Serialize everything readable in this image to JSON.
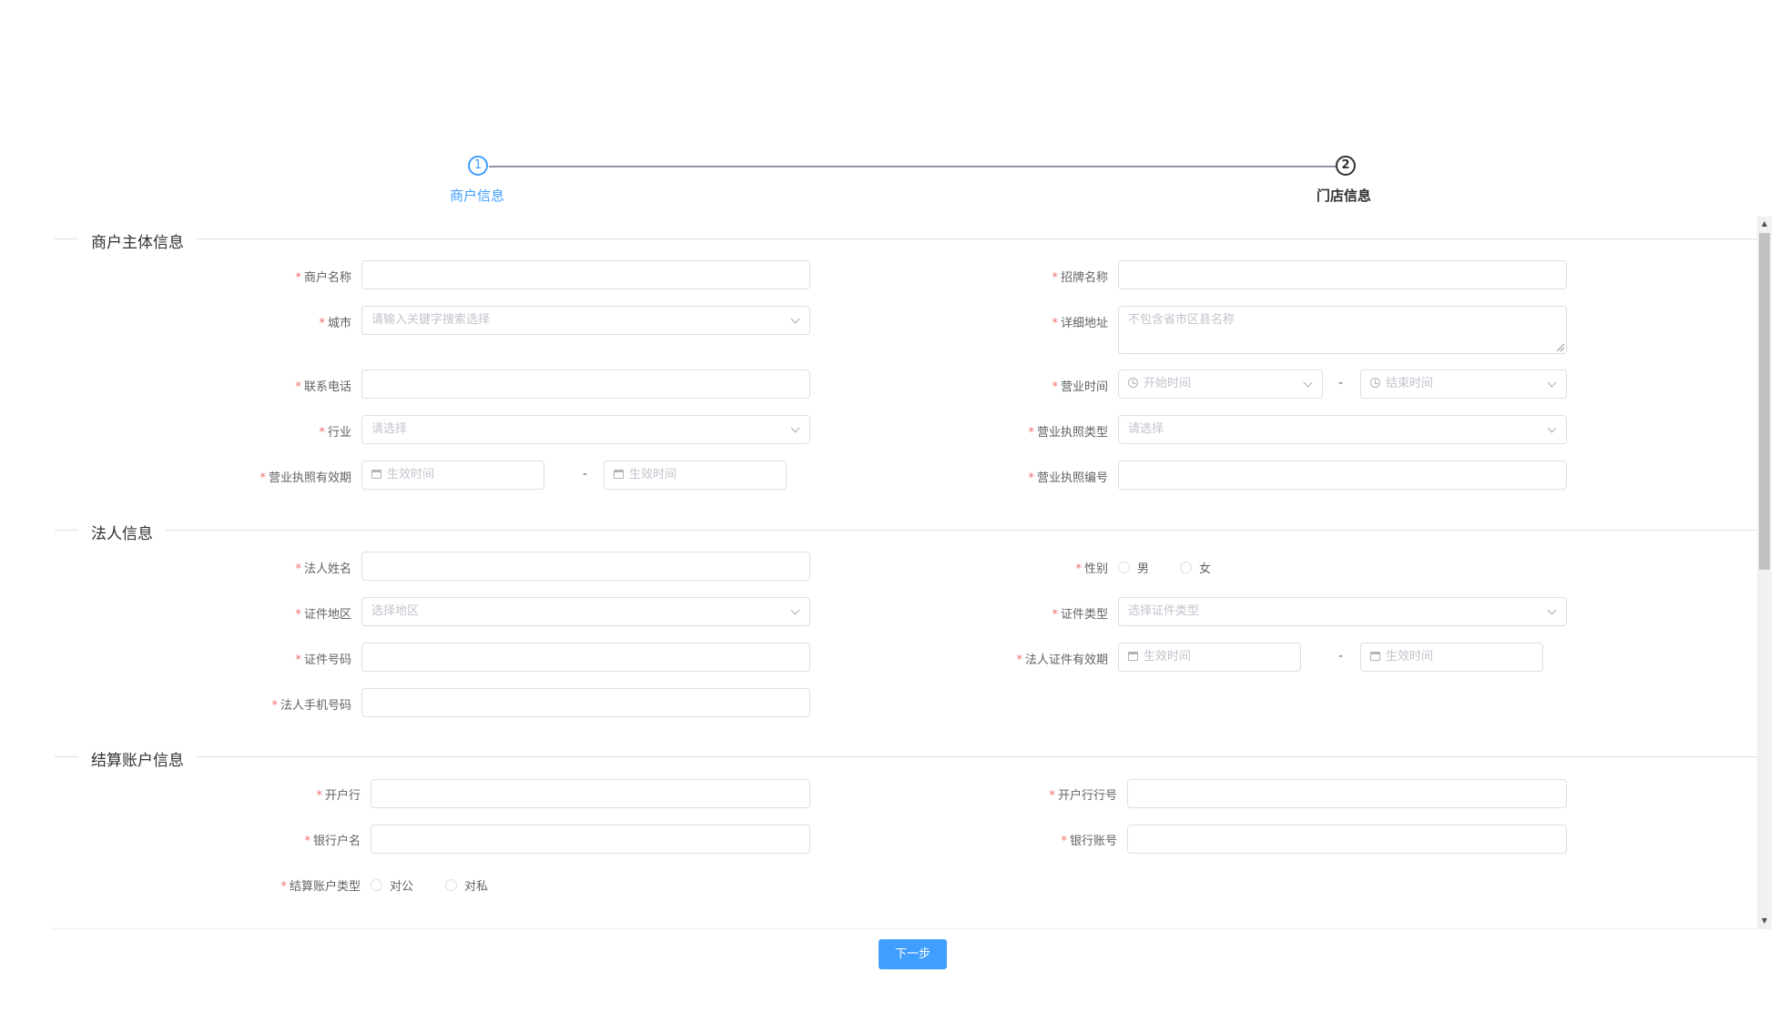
{
  "steps": [
    {
      "number": "1",
      "label": "商户信息"
    },
    {
      "number": "2",
      "label": "门店信息"
    }
  ],
  "sections": {
    "merchant": "商户主体信息",
    "legal": "法人信息",
    "settlement": "结算账户信息"
  },
  "fields": {
    "merchant_name": {
      "label": "商户名称"
    },
    "brand_name": {
      "label": "招牌名称"
    },
    "city": {
      "label": "城市",
      "placeholder": "请输入关键字搜索选择"
    },
    "address": {
      "label": "详细地址",
      "placeholder": "不包含省市区县名称"
    },
    "phone": {
      "label": "联系电话"
    },
    "business_hours": {
      "label": "营业时间",
      "start": "开始时间",
      "end": "结束时间"
    },
    "industry": {
      "label": "行业",
      "placeholder": "请选择"
    },
    "license_type": {
      "label": "营业执照类型",
      "placeholder": "请选择"
    },
    "license_validity": {
      "label": "营业执照有效期",
      "start": "生效时间",
      "end": "生效时间"
    },
    "license_number": {
      "label": "营业执照编号"
    },
    "legal_name": {
      "label": "法人姓名"
    },
    "gender": {
      "label": "性别",
      "options": [
        "男",
        "女"
      ]
    },
    "id_region": {
      "label": "证件地区",
      "placeholder": "选择地区"
    },
    "id_type": {
      "label": "证件类型",
      "placeholder": "选择证件类型"
    },
    "id_number": {
      "label": "证件号码"
    },
    "id_validity": {
      "label": "法人证件有效期",
      "start": "生效时间",
      "end": "生效时间"
    },
    "legal_phone": {
      "label": "法人手机号码"
    },
    "bank": {
      "label": "开户行"
    },
    "bank_code": {
      "label": "开户行行号"
    },
    "account_name": {
      "label": "银行户名"
    },
    "account_number": {
      "label": "银行账号"
    },
    "account_type": {
      "label": "结算账户类型",
      "options": [
        "对公",
        "对私"
      ]
    }
  },
  "required_mark": "*",
  "range_separator": "-",
  "next_button": "下一步"
}
